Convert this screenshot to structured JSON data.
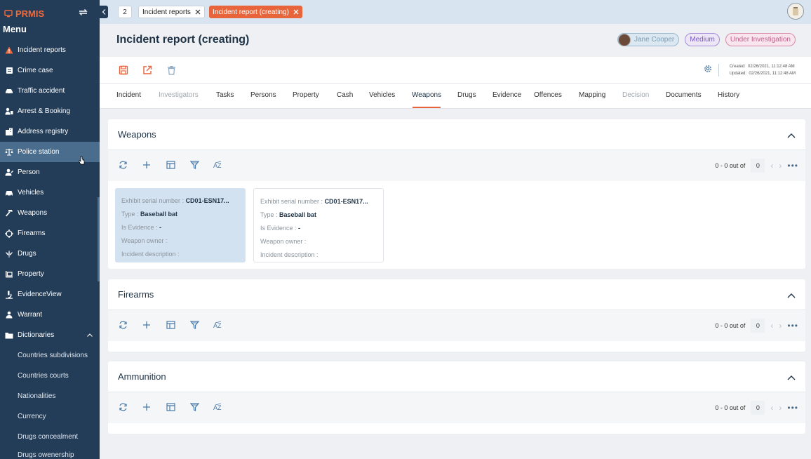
{
  "app": {
    "name": "PRMIS",
    "menu_title": "Menu"
  },
  "sidebar": {
    "items": [
      {
        "label": "Incident reports",
        "icon": "warning-icon"
      },
      {
        "label": "Crime case",
        "icon": "case-icon"
      },
      {
        "label": "Traffic accident",
        "icon": "car-crash-icon"
      },
      {
        "label": "Arrest & Booking",
        "icon": "handcuff-icon"
      },
      {
        "label": "Address registry",
        "icon": "building-icon"
      },
      {
        "label": "Police station",
        "icon": "scale-icon"
      },
      {
        "label": "Person",
        "icon": "person-icon"
      },
      {
        "label": "Vehicles",
        "icon": "car-icon"
      },
      {
        "label": "Weapons",
        "icon": "hammer-icon"
      },
      {
        "label": "Firearms",
        "icon": "crosshair-icon"
      },
      {
        "label": "Drugs",
        "icon": "leaf-icon"
      },
      {
        "label": "Property",
        "icon": "property-icon"
      },
      {
        "label": "EvidenceView",
        "icon": "microscope-icon"
      },
      {
        "label": "Warrant",
        "icon": "warrant-icon"
      },
      {
        "label": "Dictionaries",
        "icon": "folder-icon"
      }
    ],
    "sub_items": [
      {
        "label": "Countries subdivisions"
      },
      {
        "label": "Countries courts"
      },
      {
        "label": "Nationalities"
      },
      {
        "label": "Currency"
      },
      {
        "label": "Drugs concealment"
      },
      {
        "label": "Drugs owenership"
      }
    ]
  },
  "topbar": {
    "tab_count": "2",
    "tabs": [
      {
        "label": "Incident reports"
      },
      {
        "label": "Incident report (creating)"
      }
    ]
  },
  "header": {
    "title": "Incident report (creating)",
    "user": "Jane Cooper",
    "priority": "Medium",
    "status": "Under Investigation"
  },
  "meta": {
    "created_label": "Created:",
    "created": "02/26/2021, 11:12:48 AM",
    "updated_label": "Updated:",
    "updated": "02/26/2021, 11:12:48 AM"
  },
  "tabs": [
    {
      "label": "Incident"
    },
    {
      "label": "Investigators"
    },
    {
      "label": "Tasks"
    },
    {
      "label": "Persons"
    },
    {
      "label": "Property"
    },
    {
      "label": "Cash"
    },
    {
      "label": "Vehicles"
    },
    {
      "label": "Weapons"
    },
    {
      "label": "Drugs"
    },
    {
      "label": "Evidence"
    },
    {
      "label": "Offences"
    },
    {
      "label": "Mapping"
    },
    {
      "label": "Decision"
    },
    {
      "label": "Documents"
    },
    {
      "label": "History"
    }
  ],
  "sections": [
    {
      "title": "Weapons",
      "pager": "0 - 0 out of",
      "count": "0"
    },
    {
      "title": "Firearms",
      "pager": "0 - 0 out of",
      "count": "0"
    },
    {
      "title": "Ammunition",
      "pager": "0 - 0 out of",
      "count": "0"
    }
  ],
  "weapon_cards": [
    {
      "serial_label": "Exhibit serial number :",
      "serial": "CD01-ESN17...",
      "type_label": "Type :",
      "type": "Baseball bat",
      "evidence_label": "Is Evidence :",
      "evidence": "-",
      "owner_label": "Weapon owner :",
      "desc_label": "Incident description :"
    },
    {
      "serial_label": "Exhibit serial number :",
      "serial": "CD01-ESN17...",
      "type_label": "Type :",
      "type": "Baseball bat",
      "evidence_label": "Is Evidence :",
      "evidence": "-",
      "owner_label": "Weapon owner :",
      "desc_label": "Incident description :"
    }
  ],
  "colors": {
    "accent": "#e8643a",
    "sidebar": "#233d58",
    "sidebar_active": "#4b6d8d"
  }
}
